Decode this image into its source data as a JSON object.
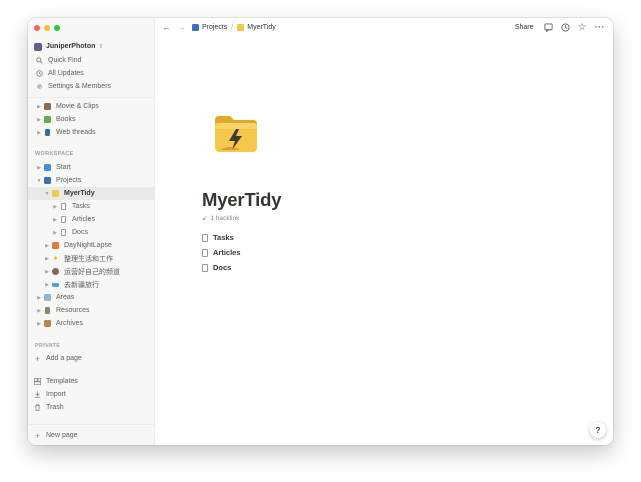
{
  "workspace": {
    "name": "JuniperPhoton"
  },
  "sidebar": {
    "top_items": [
      {
        "label": "Quick Find",
        "icon": "search-icon"
      },
      {
        "label": "All Updates",
        "icon": "clock-icon"
      },
      {
        "label": "Settings & Members",
        "icon": "gear-icon"
      }
    ],
    "favorites": [
      {
        "label": "Movie & Clips",
        "icon": "film-icon"
      },
      {
        "label": "Books",
        "icon": "books-icon"
      },
      {
        "label": "Web threads",
        "icon": "book-icon"
      }
    ],
    "workspace_label": "WORKSPACE",
    "workspace_items": [
      {
        "label": "Start"
      },
      {
        "label": "Projects"
      },
      {
        "label": "MyerTidy"
      },
      {
        "label": "Tasks"
      },
      {
        "label": "Articles"
      },
      {
        "label": "Docs"
      },
      {
        "label": "DayNightLapse"
      },
      {
        "label": "整理生活和工作"
      },
      {
        "label": "运营好自己的频道"
      },
      {
        "label": "去新疆旅行"
      },
      {
        "label": "Areas"
      },
      {
        "label": "Resources"
      },
      {
        "label": "Archives"
      }
    ],
    "private_label": "PRIVATE",
    "add_page": "Add a page",
    "bottom_items": [
      {
        "label": "Templates",
        "icon": "templates-icon"
      },
      {
        "label": "Import",
        "icon": "import-icon"
      },
      {
        "label": "Trash",
        "icon": "trash-icon"
      }
    ],
    "new_page": "New page"
  },
  "topbar": {
    "breadcrumb": [
      "Projects",
      "MyerTidy"
    ],
    "separator": "/",
    "share": "Share"
  },
  "page": {
    "title": "MyerTidy",
    "backlink": "1 backlink",
    "children": [
      "Tasks",
      "Articles",
      "Docs"
    ]
  },
  "help": "?",
  "colors": {
    "sidebar_bg": "#f7f7f5",
    "selected_bg": "#e9e9e7",
    "text": "#37352f",
    "folder": "#f5c84a"
  }
}
